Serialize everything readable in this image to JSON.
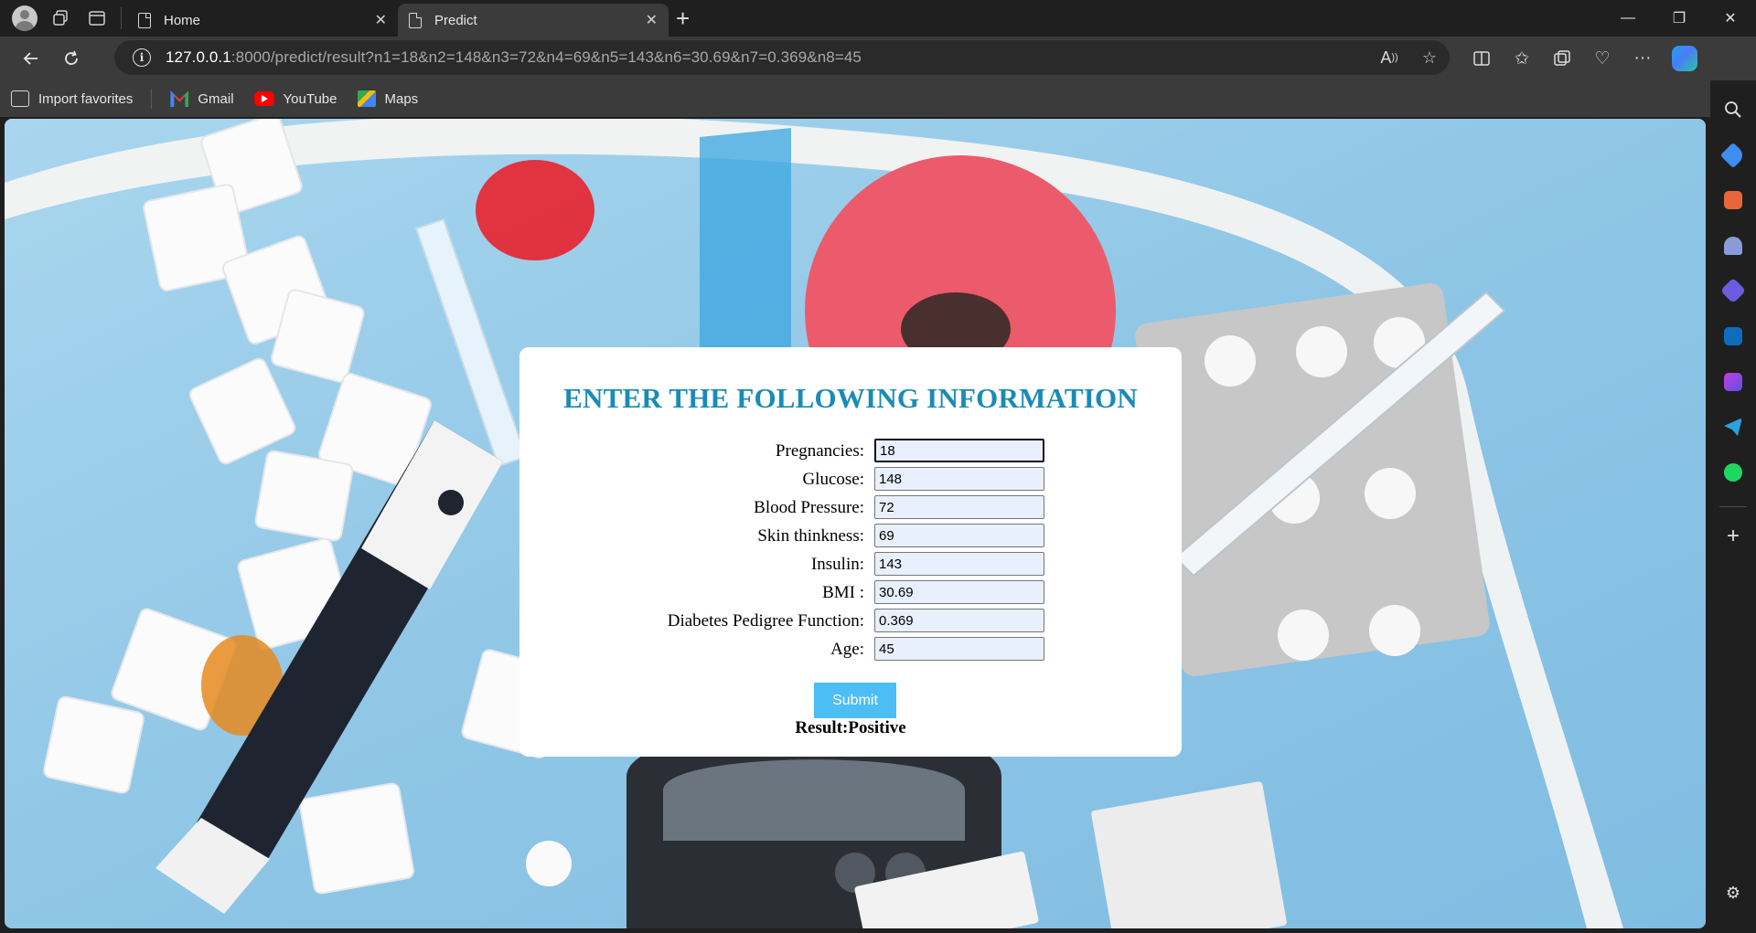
{
  "browser": {
    "tabs": [
      {
        "label": "Home"
      },
      {
        "label": "Predict"
      }
    ],
    "url_host": "127.0.0.1",
    "url_rest": ":8000/predict/result?n1=18&n2=148&n3=72&n4=69&n5=143&n6=30.69&n7=0.369&n8=45",
    "favorites": [
      {
        "label": "Import favorites"
      },
      {
        "label": "Gmail"
      },
      {
        "label": "YouTube"
      },
      {
        "label": "Maps"
      }
    ]
  },
  "form": {
    "title": "ENTER THE FOLLOWING INFORMATION",
    "fields": [
      {
        "label": "Pregnancies:",
        "value": "18"
      },
      {
        "label": "Glucose:",
        "value": "148"
      },
      {
        "label": "Blood Pressure:",
        "value": "72"
      },
      {
        "label": "Skin thinkness:",
        "value": "69"
      },
      {
        "label": "Insulin:",
        "value": "143"
      },
      {
        "label": "BMI :",
        "value": "30.69"
      },
      {
        "label": "Diabetes Pedigree Function:",
        "value": "0.369"
      },
      {
        "label": "Age:",
        "value": "45"
      }
    ],
    "submit_label": "Submit",
    "result_text": "Result:Positive"
  },
  "colors": {
    "title": "#1a8bb5",
    "submit_bg": "#4dbdf5",
    "input_bg": "#e8f0fe",
    "page_bg": "#9fcde8"
  }
}
